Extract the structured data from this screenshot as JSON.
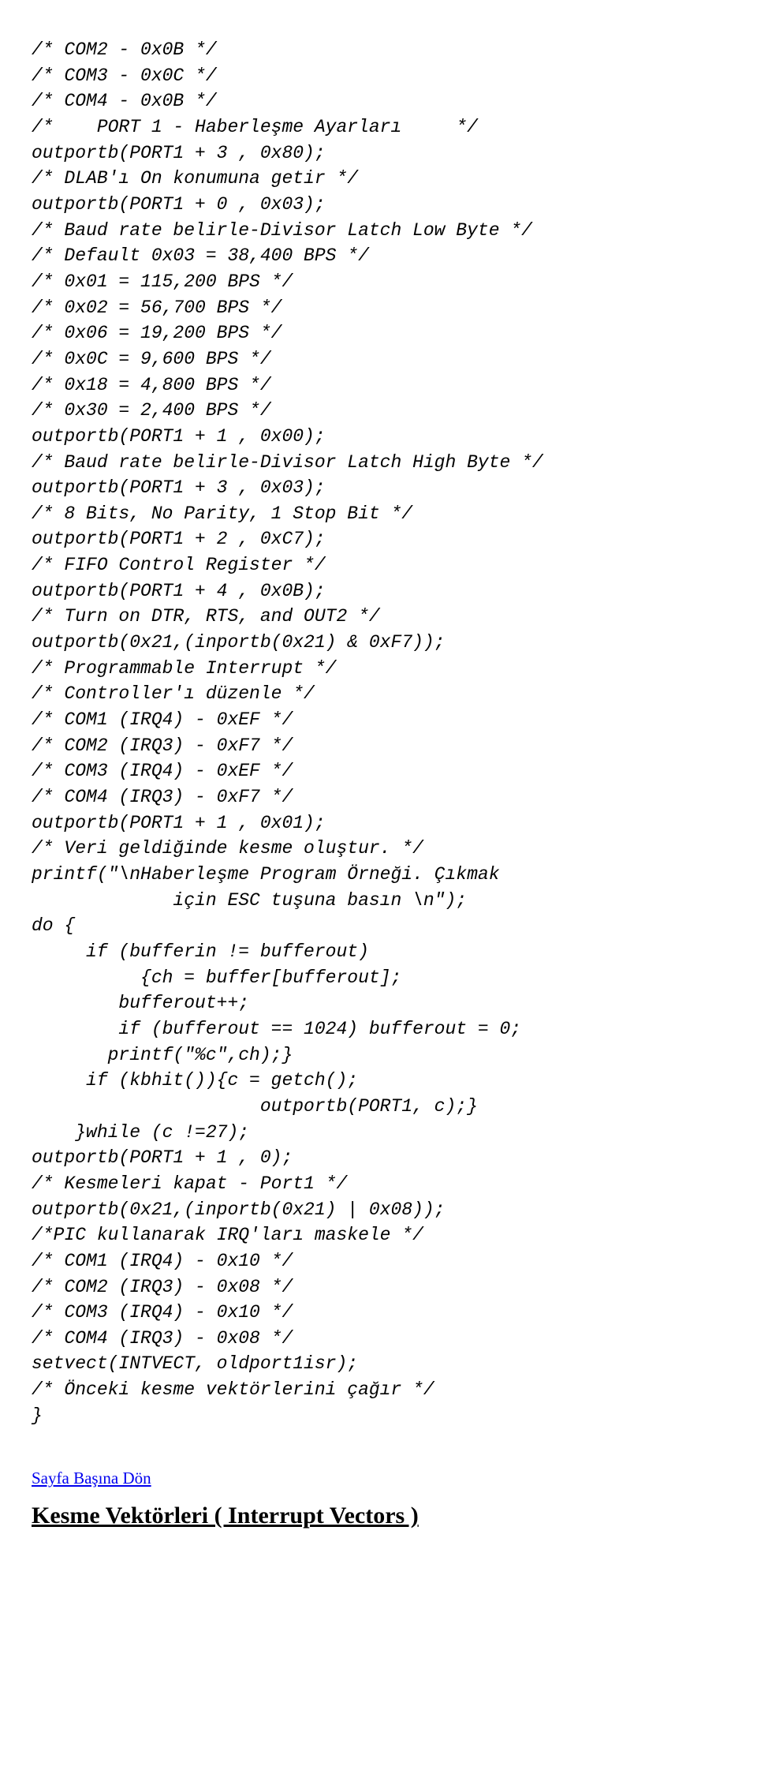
{
  "lines": [
    "/* COM2 - 0x0B */",
    "/* COM3 - 0x0C */",
    "/* COM4 - 0x0B */",
    "/*    PORT 1 - Haberleşme Ayarları     */",
    "outportb(PORT1 + 3 , 0x80);",
    "/* DLAB'ı On konumuna getir */",
    "outportb(PORT1 + 0 , 0x03);",
    "/* Baud rate belirle-Divisor Latch Low Byte */",
    "/* Default 0x03 = 38,400 BPS */",
    "/* 0x01 = 115,200 BPS */",
    "/* 0x02 = 56,700 BPS */",
    "/* 0x06 = 19,200 BPS */",
    "/* 0x0C = 9,600 BPS */",
    "/* 0x18 = 4,800 BPS */",
    "/* 0x30 = 2,400 BPS */",
    "outportb(PORT1 + 1 , 0x00);",
    "/* Baud rate belirle-Divisor Latch High Byte */",
    "outportb(PORT1 + 3 , 0x03);",
    "/* 8 Bits, No Parity, 1 Stop Bit */",
    "outportb(PORT1 + 2 , 0xC7);",
    "/* FIFO Control Register */",
    "outportb(PORT1 + 4 , 0x0B);",
    "/* Turn on DTR, RTS, and OUT2 */",
    "outportb(0x21,(inportb(0x21) & 0xF7));",
    "/* Programmable Interrupt */",
    "/* Controller'ı düzenle */",
    "/* COM1 (IRQ4) - 0xEF */",
    "/* COM2 (IRQ3) - 0xF7 */",
    "/* COM3 (IRQ4) - 0xEF */",
    "/* COM4 (IRQ3) - 0xF7 */",
    "outportb(PORT1 + 1 , 0x01);",
    "/* Veri geldiğinde kesme oluştur. */",
    "printf(\"\\nHaberleşme Program Örneği. Çıkmak",
    "             için ESC tuşuna basın \\n\");",
    "do {",
    "     if (bufferin != bufferout)",
    "          {ch = buffer[bufferout];",
    "        bufferout++;",
    "        if (bufferout == 1024) bufferout = 0;",
    "       printf(\"%c\",ch);}",
    "     if (kbhit()){c = getch();",
    "                     outportb(PORT1, c);}",
    "    }while (c !=27);",
    "outportb(PORT1 + 1 , 0);",
    "/* Kesmeleri kapat - Port1 */",
    "outportb(0x21,(inportb(0x21) | 0x08));",
    "/*PIC kullanarak IRQ'ları maskele */",
    "/* COM1 (IRQ4) - 0x10 */",
    "/* COM2 (IRQ3) - 0x08 */",
    "/* COM3 (IRQ4) - 0x10 */",
    "/* COM4 (IRQ3) - 0x08 */",
    "setvect(INTVECT, oldport1isr);",
    "/* Önceki kesme vektörlerini çağır */",
    "}"
  ],
  "link_text": "Sayfa Başına Dön",
  "heading": "Kesme Vektörleri ( Interrupt Vectors )"
}
